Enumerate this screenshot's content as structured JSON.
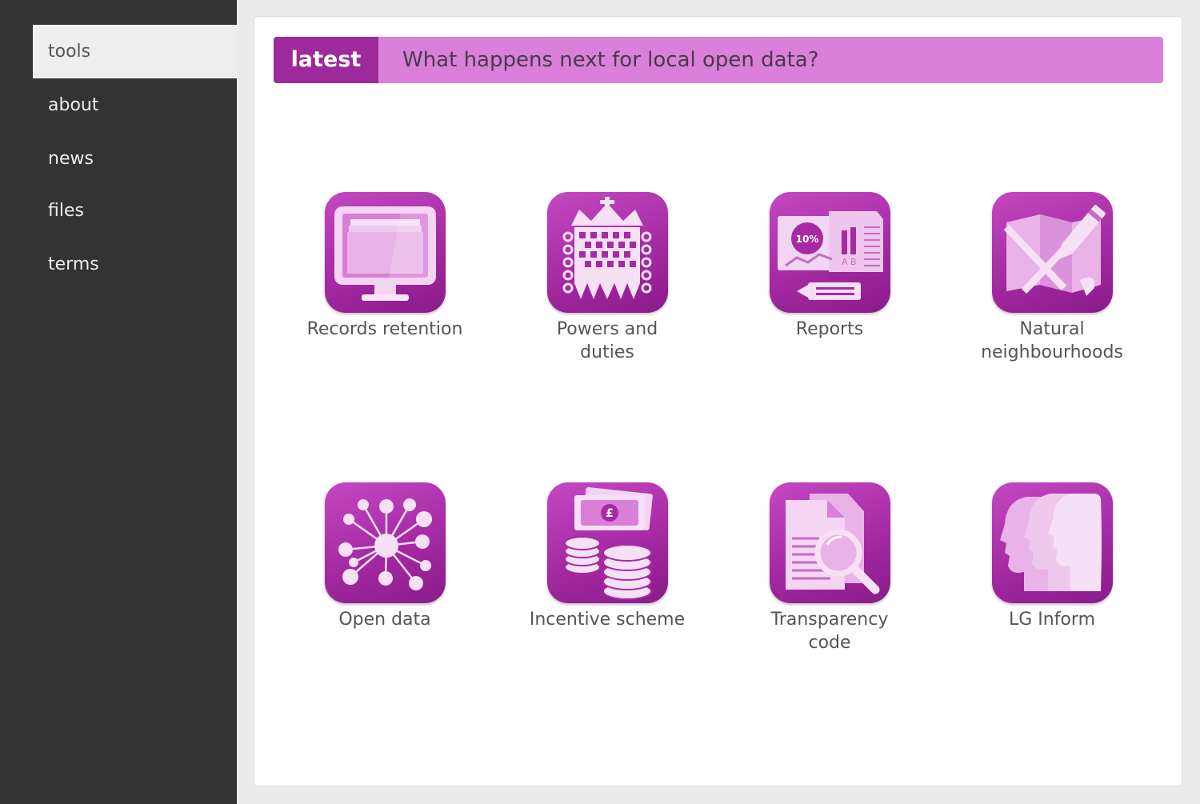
{
  "sidebar": {
    "items": [
      {
        "label": "tools",
        "active": true
      },
      {
        "label": "about"
      },
      {
        "label": "news"
      },
      {
        "label": "files"
      },
      {
        "label": "terms"
      }
    ]
  },
  "latest": {
    "tag": "latest",
    "headline": "What happens next for local open data?"
  },
  "tools": [
    {
      "label": "Records retention",
      "icon": "monitor-icon"
    },
    {
      "label": "Powers and duties",
      "icon": "portcullis-icon"
    },
    {
      "label": "Reports",
      "icon": "report-icon"
    },
    {
      "label": "Natural neighbourhoods",
      "icon": "map-icon"
    },
    {
      "label": "Open data",
      "icon": "network-icon"
    },
    {
      "label": "Incentive scheme",
      "icon": "money-icon"
    },
    {
      "label": "Transparency code",
      "icon": "magnifier-document-icon"
    },
    {
      "label": "LG Inform",
      "icon": "profile-faces-icon"
    }
  ],
  "icon_text": {
    "report_percent": "10%",
    "report_ab": "A B",
    "currency_symbol": "£"
  },
  "colors": {
    "accent": "#9c2a9a",
    "banner": "#da7fda",
    "sidebar": "#333333"
  }
}
